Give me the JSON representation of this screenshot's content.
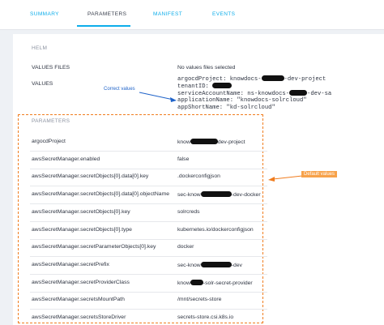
{
  "tabs": [
    "SUMMARY",
    "PARAMETERS",
    "MANIFEST",
    "EVENTS"
  ],
  "helm": {
    "header": "HELM",
    "values_files_label": "VALUES FILES",
    "values_files_value": "No values files selected",
    "values_label": "VALUES",
    "values_lines": [
      {
        "a": "argocdProject: knowdocs-",
        "b": "-dev-project"
      },
      {
        "a": "tenantID: ",
        "b": ""
      },
      {
        "a": "serviceAccountName: ns-knowdocs-",
        "b": "-dev-sa"
      },
      {
        "a": "applicationName: \"knowdocs-solrcloud\"",
        "b": ""
      },
      {
        "a": "appShortName: \"kd-solrcloud\"",
        "b": ""
      }
    ]
  },
  "parameters": {
    "header": "PARAMETERS",
    "rows": [
      {
        "name": "argocdProject",
        "value_a": "know",
        "value_b": "dev-project"
      },
      {
        "name": "awsSecretManager.enabled",
        "value_a": "false",
        "value_b": ""
      },
      {
        "name": "awsSecretManager.secretObjects[0].data[0].key",
        "value_a": ".dockerconfigjson",
        "value_b": ""
      },
      {
        "name": "awsSecretManager.secretObjects[0].data[0].objectName",
        "value_a": "sec-know",
        "value_b": "-dev-docker"
      },
      {
        "name": "awsSecretManager.secretObjects[0].key",
        "value_a": "solrcreds",
        "value_b": ""
      },
      {
        "name": "awsSecretManager.secretObjects[0].type",
        "value_a": "kubernetes.io/dockerconfigjson",
        "value_b": ""
      },
      {
        "name": "awsSecretManager.secretParameterObjects[0].key",
        "value_a": "docker",
        "value_b": ""
      },
      {
        "name": "awsSecretManager.secretPrefix",
        "value_a": "sec-know",
        "value_b": "-dev"
      },
      {
        "name": "awsSecretManager.secretProviderClass",
        "value_a": "know",
        "value_b": "-solr-secret-provider"
      },
      {
        "name": "awsSecretManager.secretsMountPath",
        "value_a": "/mnt/secrets-store",
        "value_b": ""
      },
      {
        "name": "awsSecretManager.secretsStoreDriver",
        "value_a": "secrets-store.csi.k8s.io",
        "value_b": ""
      }
    ]
  },
  "annotations": {
    "correct": "Correct values",
    "default": "Default values"
  }
}
